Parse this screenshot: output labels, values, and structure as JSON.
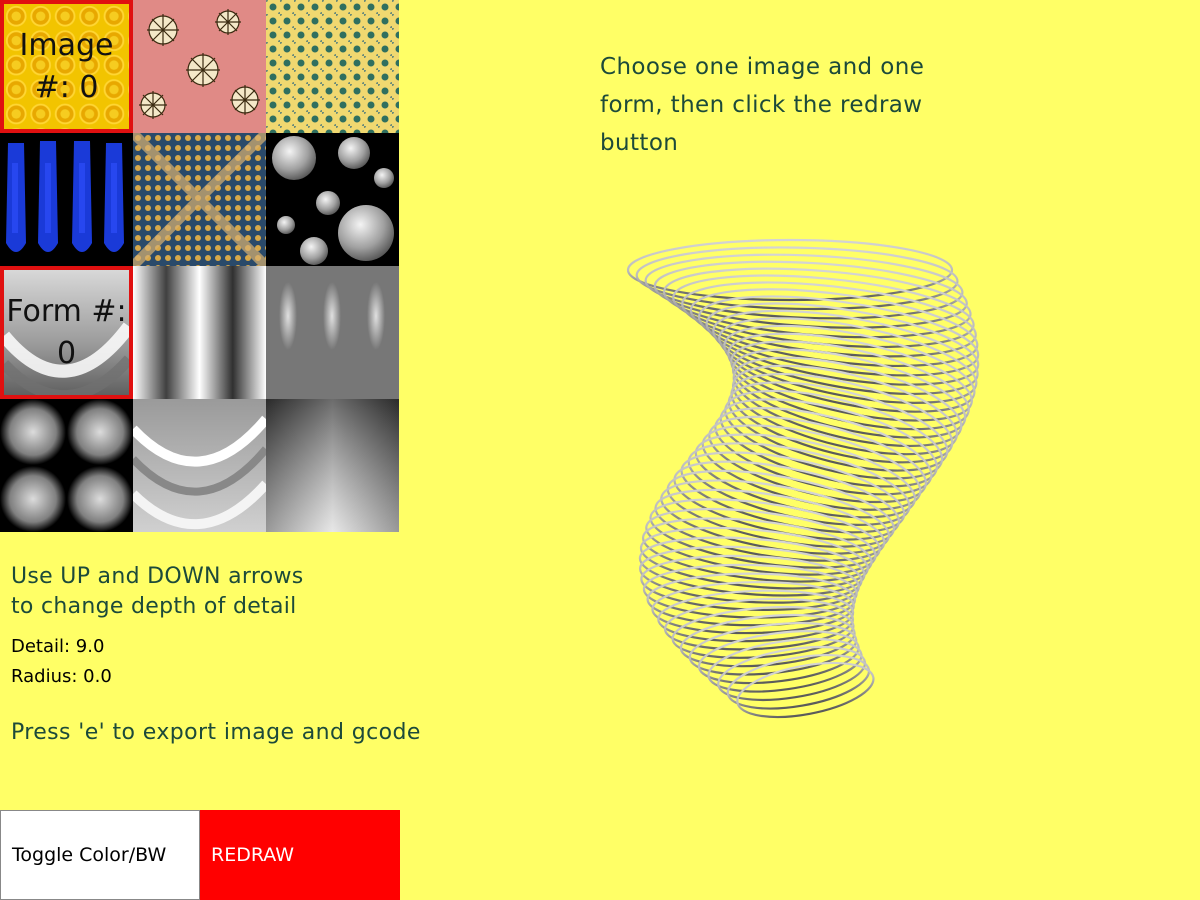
{
  "image_tiles": [
    {
      "name": "image-tile-0",
      "label": "Image\n#: 0",
      "selected": true
    },
    {
      "name": "image-tile-1",
      "label": "",
      "selected": false
    },
    {
      "name": "image-tile-2",
      "label": "",
      "selected": false
    },
    {
      "name": "image-tile-3",
      "label": "",
      "selected": false
    },
    {
      "name": "image-tile-4",
      "label": "",
      "selected": false
    },
    {
      "name": "image-tile-5",
      "label": "",
      "selected": false
    }
  ],
  "form_tiles": [
    {
      "name": "form-tile-0",
      "label": "Form #:\n0",
      "selected": true
    },
    {
      "name": "form-tile-1",
      "label": "",
      "selected": false
    },
    {
      "name": "form-tile-2",
      "label": "",
      "selected": false
    },
    {
      "name": "form-tile-3",
      "label": "",
      "selected": false
    },
    {
      "name": "form-tile-4",
      "label": "",
      "selected": false
    },
    {
      "name": "form-tile-5",
      "label": "",
      "selected": false
    }
  ],
  "instructions": {
    "main": "Choose one image and one form, then click the redraw button",
    "arrows_line1": "Use UP and DOWN arrows",
    "arrows_line2": "to change depth of detail",
    "export": "Press 'e' to export image and gcode"
  },
  "stats": {
    "detail": "Detail: 9.0",
    "radius": "Radius: 0.0"
  },
  "buttons": {
    "toggle_label": "Toggle Color/BW",
    "redraw_label": "REDRAW"
  },
  "colors": {
    "background": "#ffff66",
    "selection_border": "#e01010",
    "instruction_text": "#1c4a3a",
    "redraw_button": "#ff0000"
  }
}
